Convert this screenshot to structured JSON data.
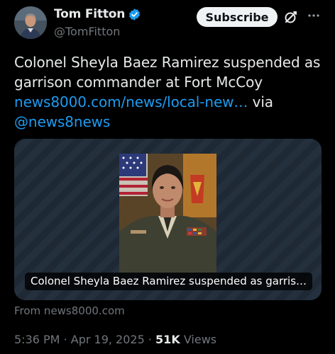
{
  "author": {
    "display_name": "Tom Fitton",
    "handle": "@TomFitton",
    "verified": true
  },
  "actions": {
    "subscribe_label": "Subscribe",
    "grok_icon": "grok-icon",
    "more_icon": "more-icon"
  },
  "tweet": {
    "text_main": "Colonel Sheyla Baez Ramirez suspended as garrison commander at Fort McCoy",
    "link_text": "news8000.com/news/local-new…",
    "via_text": "via",
    "mention": "@news8news"
  },
  "card": {
    "caption": "Colonel Sheyla Baez Ramirez suspended as garris…",
    "source": "From news8000.com"
  },
  "meta": {
    "time": "5:36 PM",
    "separator": "·",
    "date": "Apr 19, 2025",
    "views_count": "51K",
    "views_label": "Views"
  },
  "colors": {
    "background": "#000000",
    "text_primary": "#e7e9ea",
    "text_secondary": "#71767b",
    "link": "#1d9bf0",
    "verified_badge": "#1d9bf0",
    "subscribe_bg": "#eff3f4"
  }
}
